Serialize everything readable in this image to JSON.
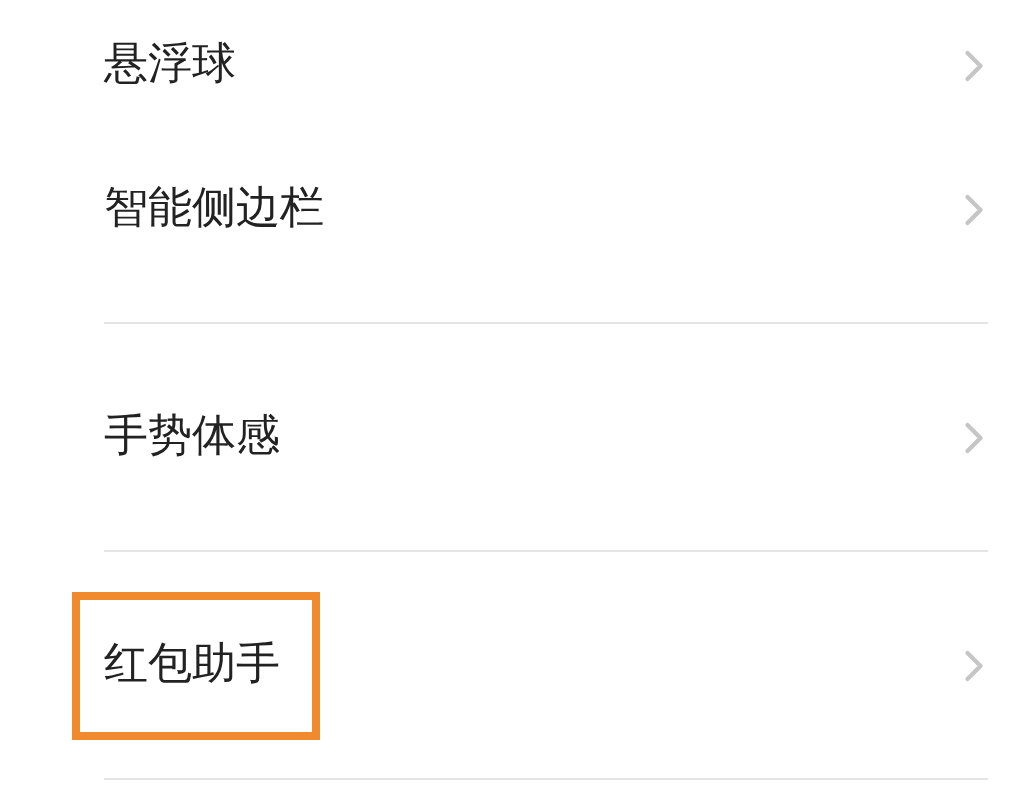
{
  "groups": [
    {
      "items": [
        {
          "label": "悬浮球",
          "highlighted": false
        },
        {
          "label": "智能侧边栏",
          "highlighted": false
        }
      ]
    },
    {
      "items": [
        {
          "label": "手势体感",
          "highlighted": false
        }
      ]
    },
    {
      "items": [
        {
          "label": "红包助手",
          "highlighted": true
        }
      ]
    }
  ]
}
